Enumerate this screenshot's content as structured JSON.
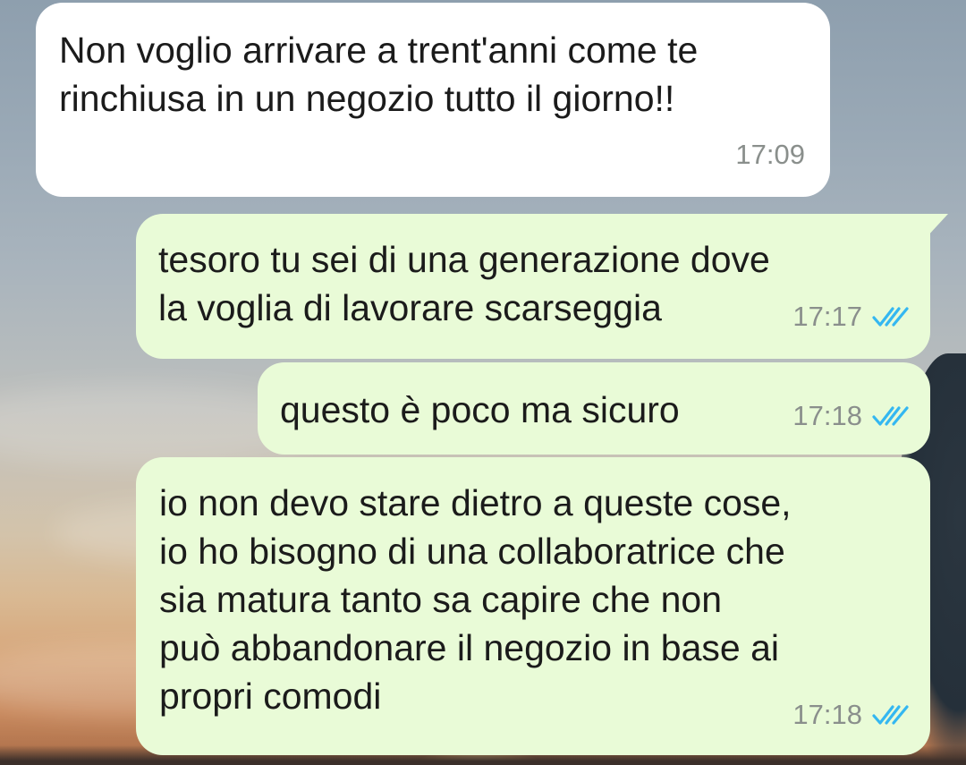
{
  "chat": {
    "messages": [
      {
        "direction": "incoming",
        "text": "Non voglio arrivare a trent'anni come te\nrinchiusa in un negozio tutto il giorno!!",
        "time": "17:09"
      },
      {
        "direction": "outgoing",
        "text": "tesoro tu sei di una generazione dove\nla voglia di lavorare scarseggia",
        "time": "17:17",
        "status": "read"
      },
      {
        "direction": "outgoing",
        "text": "questo è poco ma sicuro",
        "time": "17:18",
        "status": "read"
      },
      {
        "direction": "outgoing",
        "text": "io non devo stare dietro a queste cose,\nio ho bisogno di una collaboratrice che\nsia matura tanto sa capire che non\npuò abbandonare il negozio in base ai\npropri comodi",
        "time": "17:18",
        "status": "read"
      }
    ]
  },
  "colors": {
    "incoming_bubble": "#ffffff",
    "outgoing_bubble": "#e9fbd7",
    "read_ticks": "#34b7f1",
    "timestamp": "#8a8f8c"
  },
  "icons": {
    "read_receipt": "double-check-icon"
  }
}
